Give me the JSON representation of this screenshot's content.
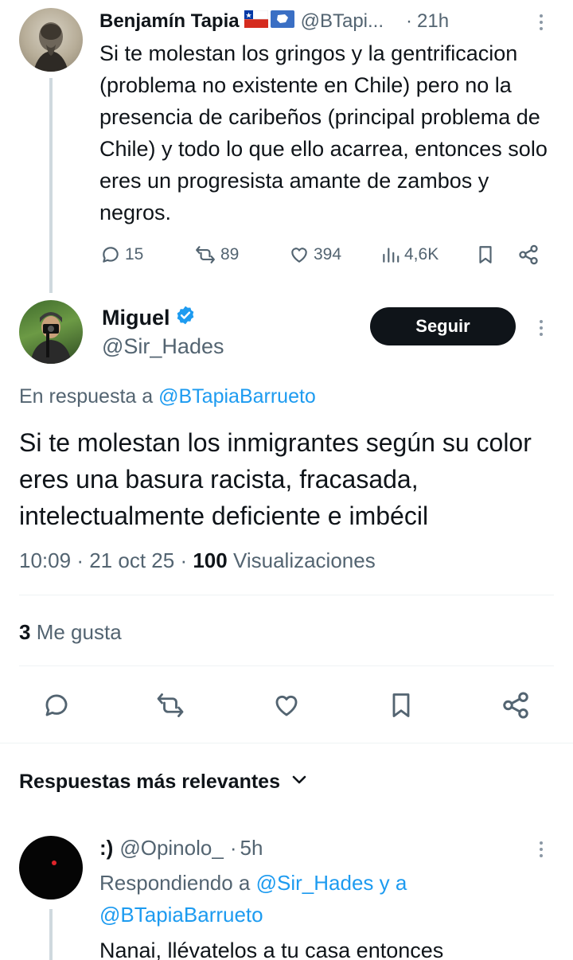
{
  "parent_tweet": {
    "name": "Benjamín Tapia",
    "handle": "@BTapi...",
    "separator": "·",
    "time": "21h",
    "text": "Si te molestan los gringos y la gentrificacion (problema no existente en Chile) pero no la presencia de caribeños (principal problema de Chile) y todo lo que ello acarrea, entonces solo eres un progresista amante de zambos y negros.",
    "replies": "15",
    "reposts": "89",
    "likes": "394",
    "views": "4,6K"
  },
  "main_tweet": {
    "name": "Miguel",
    "handle": "@Sir_Hades",
    "follow_label": "Seguir",
    "reply_prefix": "En respuesta a",
    "reply_to": "@BTapiaBarrueto",
    "text": "Si te molestan los inmigrantes según su color eres una basura racista, fracasada, intelectualmente deficiente e imbécil",
    "time": "10:09",
    "dot": "·",
    "date": "21 oct 25",
    "views_count": "100",
    "views_label": "Visualizaciones",
    "likes_count": "3",
    "likes_label": "Me gusta"
  },
  "replies_section": {
    "label": "Respuestas más relevantes"
  },
  "reply_tweet": {
    "name": ":)",
    "handle": "@Opinolo_",
    "separator": "·",
    "time": "5h",
    "replying_prefix": "Respondiendo a",
    "replying_to_1": "@Sir_Hades",
    "replying_and": "y a",
    "replying_to_2": "@BTapiaBarrueto",
    "text": "Nanai, llévatelos a tu casa entonces"
  },
  "colors": {
    "accent": "#1d9bf0",
    "text": "#0f1419",
    "muted": "#536471",
    "flag_red": "#d52b1e",
    "flag_blue": "#0039a6"
  },
  "icons": [
    "reply-icon",
    "repost-icon",
    "like-icon",
    "views-icon",
    "bookmark-icon",
    "share-icon",
    "verified-badge-icon",
    "chevron-down-icon",
    "more-icon"
  ]
}
